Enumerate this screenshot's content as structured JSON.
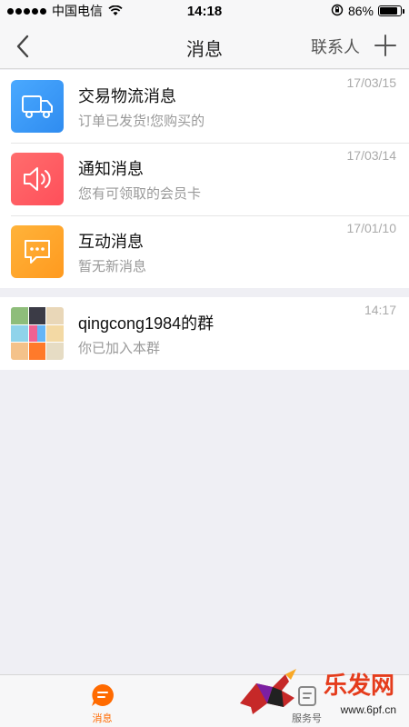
{
  "status_bar": {
    "carrier": "中国电信",
    "time": "14:18",
    "battery_percent": "86%",
    "battery_level": 0.86
  },
  "nav": {
    "title": "消息",
    "contacts_label": "联系人"
  },
  "messages": [
    {
      "title": "交易物流消息",
      "preview": "订单已发货!您购买的",
      "time": "17/03/15",
      "icon": "truck-icon",
      "color": "#3a9cf5"
    },
    {
      "title": "通知消息",
      "preview": "您有可领取的会员卡",
      "time": "17/03/14",
      "icon": "speaker-icon",
      "color": "#ff5b5b"
    },
    {
      "title": "互动消息",
      "preview": "暂无新消息",
      "time": "17/01/10",
      "icon": "chat-bubble-icon",
      "color": "#ffa726"
    }
  ],
  "groups": [
    {
      "title": "qingcong1984的群",
      "preview": "你已加入本群",
      "time": "14:17",
      "icon": "group-avatar-grid"
    }
  ],
  "tabs": [
    {
      "label": "消息",
      "icon": "message-icon",
      "active": true
    },
    {
      "label": "服务号",
      "icon": "service-icon",
      "active": false
    }
  ],
  "watermark": {
    "text": "乐发网",
    "url": "www.6pf.cn"
  },
  "colors": {
    "accent": "#ff6a00"
  }
}
